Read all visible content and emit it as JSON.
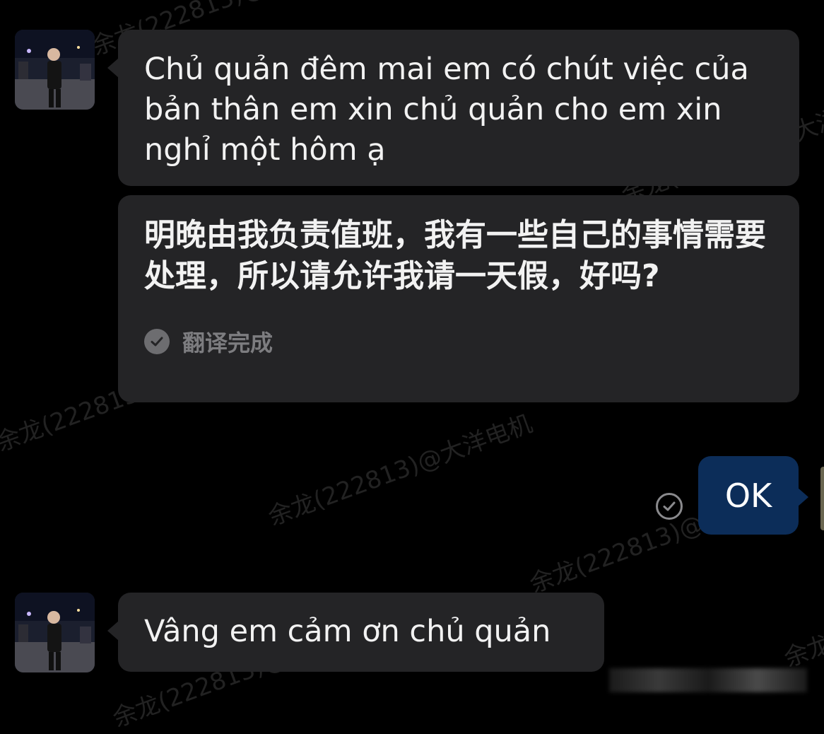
{
  "watermark": {
    "text": "余龙(222813)@大洋电机"
  },
  "messages": [
    {
      "direction": "incoming",
      "text": "Chủ quản đêm mai em có chút việc của bản thân em xin chủ quản cho em xin nghỉ một hôm ạ",
      "translation": "明晚由我负责值班，我有一些自己的事情需要处理，所以请允许我请一天假，好吗?",
      "translation_status": "翻译完成"
    },
    {
      "direction": "outgoing",
      "text": "OK",
      "read_status_icon": "check-circle-icon"
    },
    {
      "direction": "incoming",
      "text": "Vâng em cảm ơn chủ quản"
    }
  ],
  "colors": {
    "background": "#000000",
    "incoming_bubble": "#242426",
    "outgoing_bubble": "#0c2d59",
    "muted_text": "#7d7d80"
  }
}
